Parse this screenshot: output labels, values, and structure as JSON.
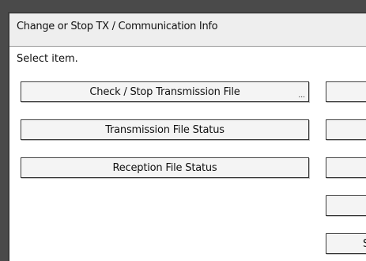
{
  "window": {
    "title": "Change or Stop TX / Communication Info"
  },
  "instruction": "Select item.",
  "left_buttons": [
    {
      "label": "Check / Stop Transmission File",
      "has_more": true,
      "more_glyph": "..."
    },
    {
      "label": "Transmission File Status"
    },
    {
      "label": "Reception File Status"
    }
  ],
  "right_buttons": [
    {
      "label": ""
    },
    {
      "label": ""
    },
    {
      "label": ""
    },
    {
      "label": ""
    },
    {
      "label": "St"
    }
  ],
  "colors": {
    "frame_border": "#4a4a4a",
    "title_bar": "#eeeeee",
    "button_face": "#f4f4f4",
    "button_border": "#333333"
  }
}
